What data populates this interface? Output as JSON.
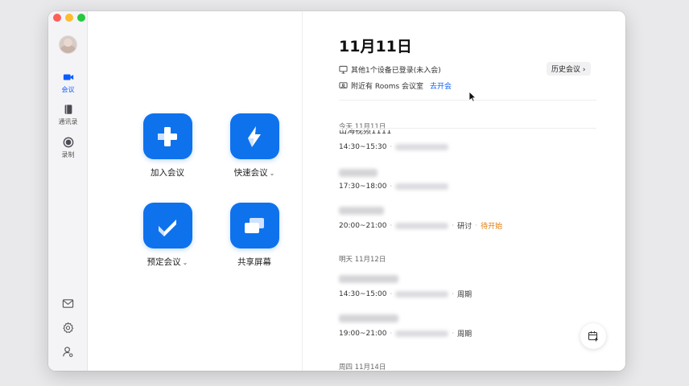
{
  "sidebar": {
    "items": [
      {
        "label": "会议",
        "icon": "video-camera-icon",
        "active": true
      },
      {
        "label": "通讯录",
        "icon": "contacts-book-icon",
        "active": false
      },
      {
        "label": "录制",
        "icon": "record-icon",
        "active": false
      }
    ],
    "bottom_icons": [
      "mail-icon",
      "gear-icon",
      "user-settings-icon"
    ]
  },
  "home": {
    "join_label": "加入会议",
    "quick_label": "快速会议",
    "schedule_label": "预定会议",
    "share_label": "共享屏幕",
    "caret": "⌄"
  },
  "panel": {
    "date_title": "11月11日",
    "device_info": "其他1个设备已登录(未入会)",
    "rooms_info": "附近有 Rooms 会议室",
    "rooms_link": "去开会",
    "history_label": "历史会议",
    "history_chevron": "›",
    "today_header": "今天 11月11日",
    "cut_title": "山海视频1111",
    "today": [
      {
        "time": "14:30~15:30"
      },
      {
        "time": "17:30~18:00"
      },
      {
        "time": "20:00~21:00",
        "tag": "研讨",
        "status": "待开始"
      }
    ],
    "tomorrow_header": "明天 11月12日",
    "tomorrow": [
      {
        "time": "14:30~15:00",
        "tag": "周期"
      },
      {
        "time": "19:00~21:00",
        "tag": "周期"
      }
    ],
    "thursday_header": "周四 11月14日",
    "separator": "·"
  },
  "colors": {
    "accent": "#0e72ed",
    "link": "#0b5cff",
    "pending": "#e27a08"
  }
}
